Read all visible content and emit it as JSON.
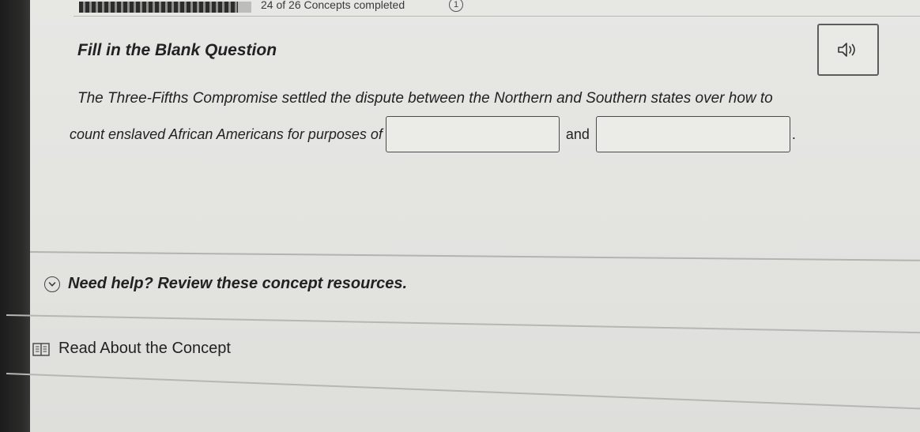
{
  "header": {
    "progress_fraction": 0.92,
    "progress_text": "24 of 26 Concepts completed",
    "info_badge": "1"
  },
  "question": {
    "title": "Fill in the Blank Question",
    "line1": "The Three-Fifths Compromise settled the dispute between the Northern and Southern states over how to",
    "line2_prefix": "count enslaved African Americans for purposes of",
    "conjunction": "and",
    "sentence_end": ".",
    "blanks": [
      {
        "value": "",
        "placeholder": ""
      },
      {
        "value": "",
        "placeholder": ""
      }
    ]
  },
  "help": {
    "toggle_label": "Need help? Review these concept resources.",
    "resources": [
      {
        "label": "Read About the Concept",
        "icon": "book-icon"
      }
    ]
  },
  "icons": {
    "audio": "speaker-icon",
    "toggle": "chevron-down-icon"
  }
}
